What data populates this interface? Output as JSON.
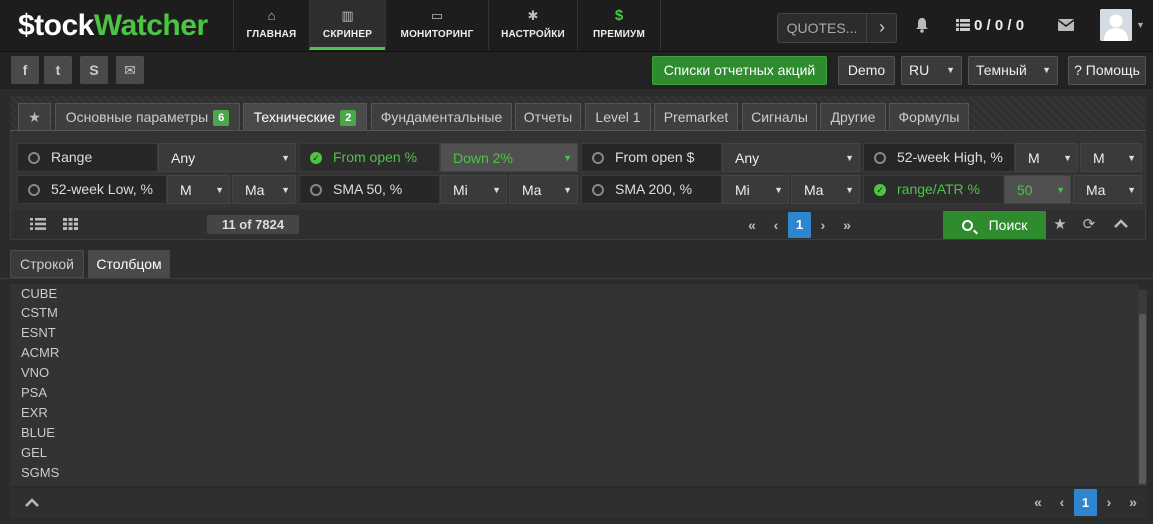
{
  "logo": {
    "part1": "$tock",
    "part2": "Watcher"
  },
  "nav": [
    {
      "label": "ГЛАВНАЯ",
      "icon": "home-icon",
      "glyph": "⌂"
    },
    {
      "label": "СКРИНЕР",
      "icon": "bar-chart-icon",
      "glyph": "▥"
    },
    {
      "label": "МОНИТОРИНГ",
      "icon": "monitor-icon",
      "glyph": "▭"
    },
    {
      "label": "НАСТРОЙКИ",
      "icon": "gear-icon",
      "glyph": "✱"
    },
    {
      "label": "ПРЕМИУМ",
      "icon": "dollar-icon",
      "glyph": "$"
    }
  ],
  "quotes": {
    "label": "QUOTES...",
    "arrow": "›"
  },
  "counters": "0 / 0 / 0",
  "social": [
    {
      "name": "facebook-icon",
      "glyph": "f"
    },
    {
      "name": "twitter-icon",
      "glyph": "t"
    },
    {
      "name": "skype-icon",
      "glyph": "S"
    },
    {
      "name": "email-icon",
      "glyph": "✉"
    }
  ],
  "toolbar": {
    "reports": "Списки отчетных акций",
    "demo": "Demo",
    "lang": "RU",
    "theme": "Темный",
    "help": "? Помощь"
  },
  "tabs": [
    {
      "label": "Основные параметры",
      "badge": "6"
    },
    {
      "label": "Технические",
      "badge": "2"
    },
    {
      "label": "Фундаментальные"
    },
    {
      "label": "Отчеты"
    },
    {
      "label": "Level 1"
    },
    {
      "label": "Premarket"
    },
    {
      "label": "Сигналы"
    },
    {
      "label": "Другие"
    },
    {
      "label": "Формулы"
    }
  ],
  "filters": {
    "range": {
      "label": "Range",
      "value": "Any"
    },
    "from_open_pct": {
      "label": "From open %",
      "value": "Down 2%"
    },
    "from_open_usd": {
      "label": "From open $",
      "value": "Any"
    },
    "high52": {
      "label": "52-week High, %",
      "min": "M",
      "max": "M"
    },
    "low52": {
      "label": "52-week Low, %",
      "min": "M",
      "max": "Ma"
    },
    "sma50": {
      "label": "SMA 50, %",
      "min": "Mi",
      "max": "Ma"
    },
    "sma200": {
      "label": "SMA 200, %",
      "min": "Mi",
      "max": "Ma"
    },
    "range_atr": {
      "label": "range/ATR %",
      "min": "50",
      "max": "Ma"
    }
  },
  "results": {
    "count": "11 of 7824",
    "page": "1",
    "search": "Поиск"
  },
  "view_tabs": [
    "Строкой",
    "Столбцом"
  ],
  "tickers": [
    "CUBE",
    "CSTM",
    "ESNT",
    "ACMR",
    "VNO",
    "PSA",
    "EXR",
    "BLUE",
    "GEL",
    "SGMS"
  ],
  "bottom": {
    "page": "1"
  },
  "colors": {
    "accent": "#4cc444",
    "primary_button": "#2e8b2e",
    "page_active": "#2f86d0"
  }
}
